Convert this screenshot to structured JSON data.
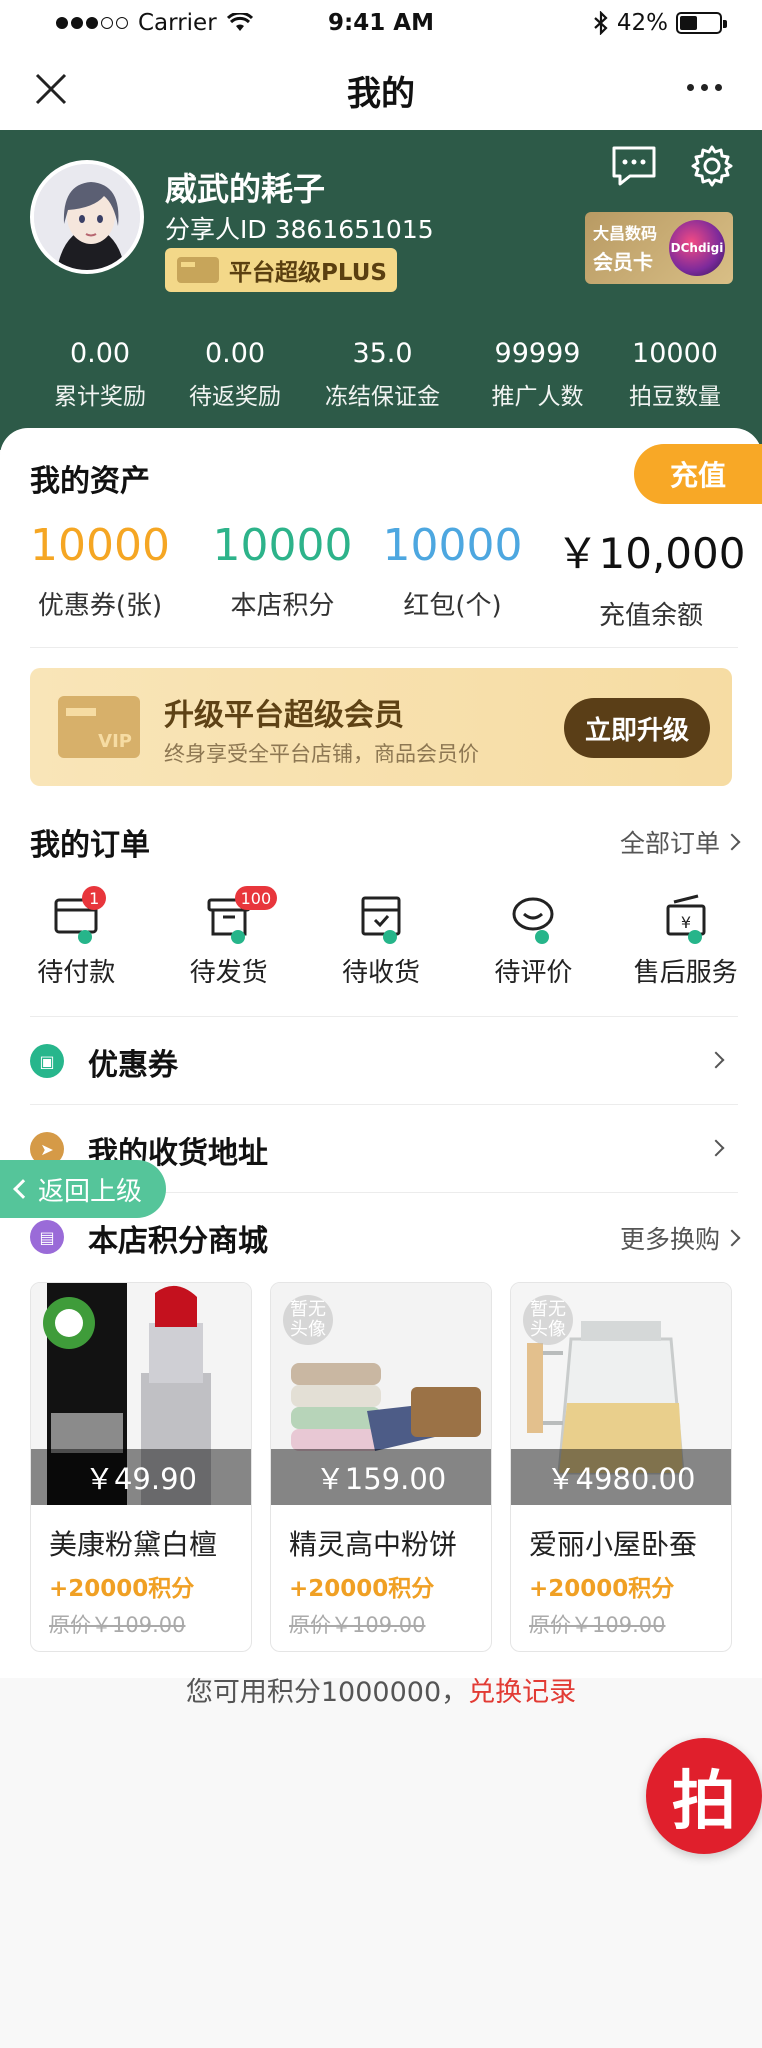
{
  "status_bar": {
    "carrier": "Carrier",
    "time": "9:41 AM",
    "battery": "42%"
  },
  "nav": {
    "title": "我的"
  },
  "profile": {
    "name": "威武的耗子",
    "share_id": "分享人ID 3861651015",
    "vip_label": "平台超级PLUS",
    "member_card_line1": "大昌数码",
    "member_card_line2": "会员卡",
    "member_card_logo": "DChdigi"
  },
  "stats": [
    {
      "value": "0.00",
      "label": "累计奖励"
    },
    {
      "value": "0.00",
      "label": "待返奖励"
    },
    {
      "value": "35.0",
      "label": "冻结保证金"
    },
    {
      "value": "99999",
      "label": "推广人数"
    },
    {
      "value": "10000",
      "label": "拍豆数量"
    }
  ],
  "assets": {
    "title": "我的资产",
    "recharge_label": "充值",
    "items": [
      {
        "value": "10000",
        "label": "优惠券(张)"
      },
      {
        "value": "10000",
        "label": "本店积分"
      },
      {
        "value": "10000",
        "label": "红包(个)"
      },
      {
        "value": "￥10,000",
        "label": "充值余额"
      }
    ]
  },
  "upgrade": {
    "title": "升级平台超级会员",
    "subtitle": "终身享受全平台店铺，商品会员价",
    "button": "立即升级"
  },
  "orders": {
    "title": "我的订单",
    "all_link": "全部订单",
    "items": [
      {
        "label": "待付款",
        "badge": "1"
      },
      {
        "label": "待发货",
        "badge": "100"
      },
      {
        "label": "待收货",
        "badge": ""
      },
      {
        "label": "待评价",
        "badge": ""
      },
      {
        "label": "售后服务",
        "badge": ""
      }
    ]
  },
  "menu": {
    "coupons": "优惠券",
    "address": "我的收货地址",
    "points_mall": "本店积分商城",
    "more_exchange": "更多换购"
  },
  "back_button": "返回上级",
  "products": [
    {
      "name": "美康粉黛白檀",
      "price": "￥49.90",
      "points": "+20000积分",
      "original": "原价￥109.00",
      "placeholder": ""
    },
    {
      "name": "精灵高中粉饼",
      "price": "￥159.00",
      "points": "+20000积分",
      "original": "原价￥109.00",
      "placeholder": "暂无头像"
    },
    {
      "name": "爱丽小屋卧蚕",
      "price": "￥4980.00",
      "points": "+20000积分",
      "original": "原价￥109.00",
      "placeholder": "暂无头像"
    }
  ],
  "points_footer": {
    "text": "您可用积分1000000，",
    "link": "兑换记录"
  },
  "float_button": "拍",
  "colors": {
    "header_green": "#2d5a48",
    "accent_orange": "#f8a826",
    "points_orange": "#f0a024",
    "link_red": "#e23b34"
  }
}
